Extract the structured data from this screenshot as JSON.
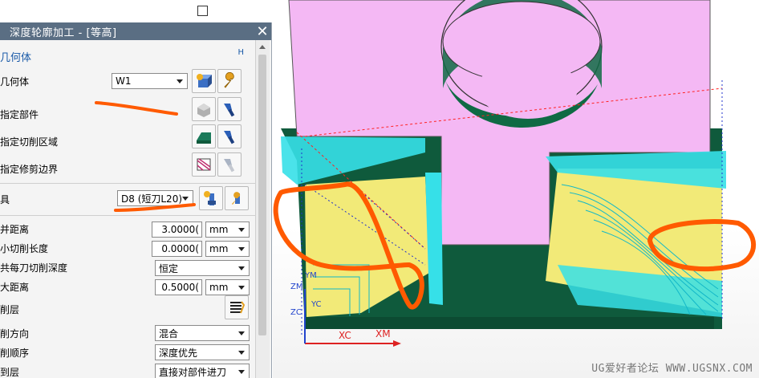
{
  "dialog": {
    "title": "深度轮廓加工 - [等高]",
    "close_symbol": "✕",
    "geometry_section": {
      "header": "几何体",
      "collapse_symbol": "H"
    },
    "geometry_row": {
      "label": "几何体",
      "value": "W1"
    },
    "part_row": {
      "label": "指定部件"
    },
    "cut_area_row": {
      "label": "指定切削区域"
    },
    "trim_boundary_row": {
      "label": "指定修剪边界"
    },
    "tool_row": {
      "label": "具",
      "value": "D8 (短刀L20)"
    },
    "merge_distance": {
      "label": "并距离",
      "value": "3.0000(",
      "unit": "mm"
    },
    "min_cut_length": {
      "label": "小切削长度",
      "value": "0.0000(",
      "unit": "mm"
    },
    "common_depth": {
      "label": "共每刀切削深度",
      "value": "恒定"
    },
    "max_distance": {
      "label": "大距离",
      "value": "0.5000(",
      "unit": "mm"
    },
    "cut_levels": {
      "label": "削层"
    },
    "cut_direction": {
      "label": "削方向",
      "value": "混合"
    },
    "cut_order": {
      "label": "削顺序",
      "value": "深度优先"
    },
    "to_level": {
      "label": "到层",
      "value": "直接对部件进刀"
    }
  },
  "viewport": {
    "axes": {
      "xc": "XC",
      "xm": "XM",
      "ym": "YM",
      "zm": "ZM",
      "zc": "ZC",
      "yc": "YC"
    },
    "watermark": "UG爱好者论坛 WWW.UGSNX.COM",
    "colors": {
      "part_top": "#f4b8f4",
      "floor": "#0f5a3c",
      "toolpath": "#36e0e8",
      "wall": "#f2ea78",
      "annotation": "#ff5a00"
    }
  }
}
